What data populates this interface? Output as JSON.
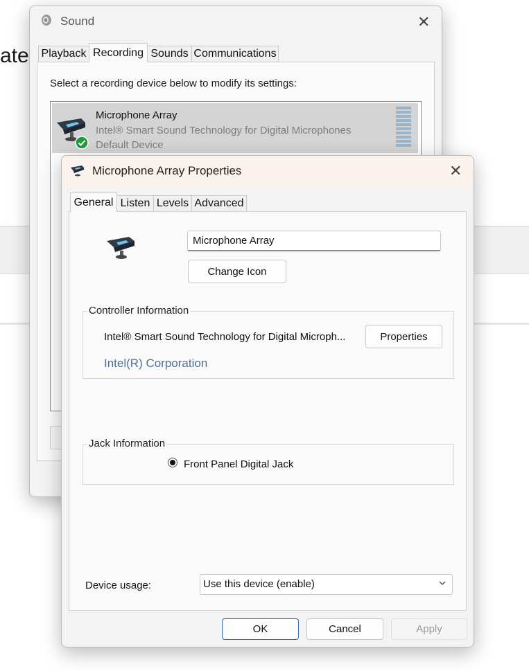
{
  "background": {
    "partial_text": "ate"
  },
  "sound_window": {
    "title": "Sound",
    "close_glyph": "✕",
    "tabs": [
      {
        "label": "Playback",
        "active": false
      },
      {
        "label": "Recording",
        "active": true
      },
      {
        "label": "Sounds",
        "active": false
      },
      {
        "label": "Communications",
        "active": false
      }
    ],
    "instruction": "Select a recording device below to modify its settings:",
    "devices": [
      {
        "name": "Microphone Array",
        "description": "Intel® Smart Sound Technology for Digital Microphones",
        "status": "Default Device",
        "icon": "microphone-array-icon",
        "badge": "default-check-icon"
      }
    ]
  },
  "properties_dialog": {
    "title": "Microphone Array Properties",
    "close_glyph": "✕",
    "tabs": [
      {
        "label": "General",
        "active": true
      },
      {
        "label": "Listen",
        "active": false
      },
      {
        "label": "Levels",
        "active": false
      },
      {
        "label": "Advanced",
        "active": false
      }
    ],
    "device_name_value": "Microphone Array",
    "change_icon_label": "Change Icon",
    "controller": {
      "group_label": "Controller Information",
      "name": "Intel® Smart Sound Technology for Digital Microph...",
      "vendor": "Intel(R) Corporation",
      "properties_label": "Properties"
    },
    "jack": {
      "group_label": "Jack Information",
      "item": "Front Panel Digital Jack"
    },
    "usage": {
      "label": "Device usage:",
      "selected": "Use this device (enable)"
    },
    "buttons": {
      "ok": "OK",
      "cancel": "Cancel",
      "apply": "Apply"
    }
  },
  "colors": {
    "link": "#4e6f98",
    "selection": "#d4d4d4",
    "ok_border": "#2b6cb0",
    "success": "#1f9d3f"
  }
}
